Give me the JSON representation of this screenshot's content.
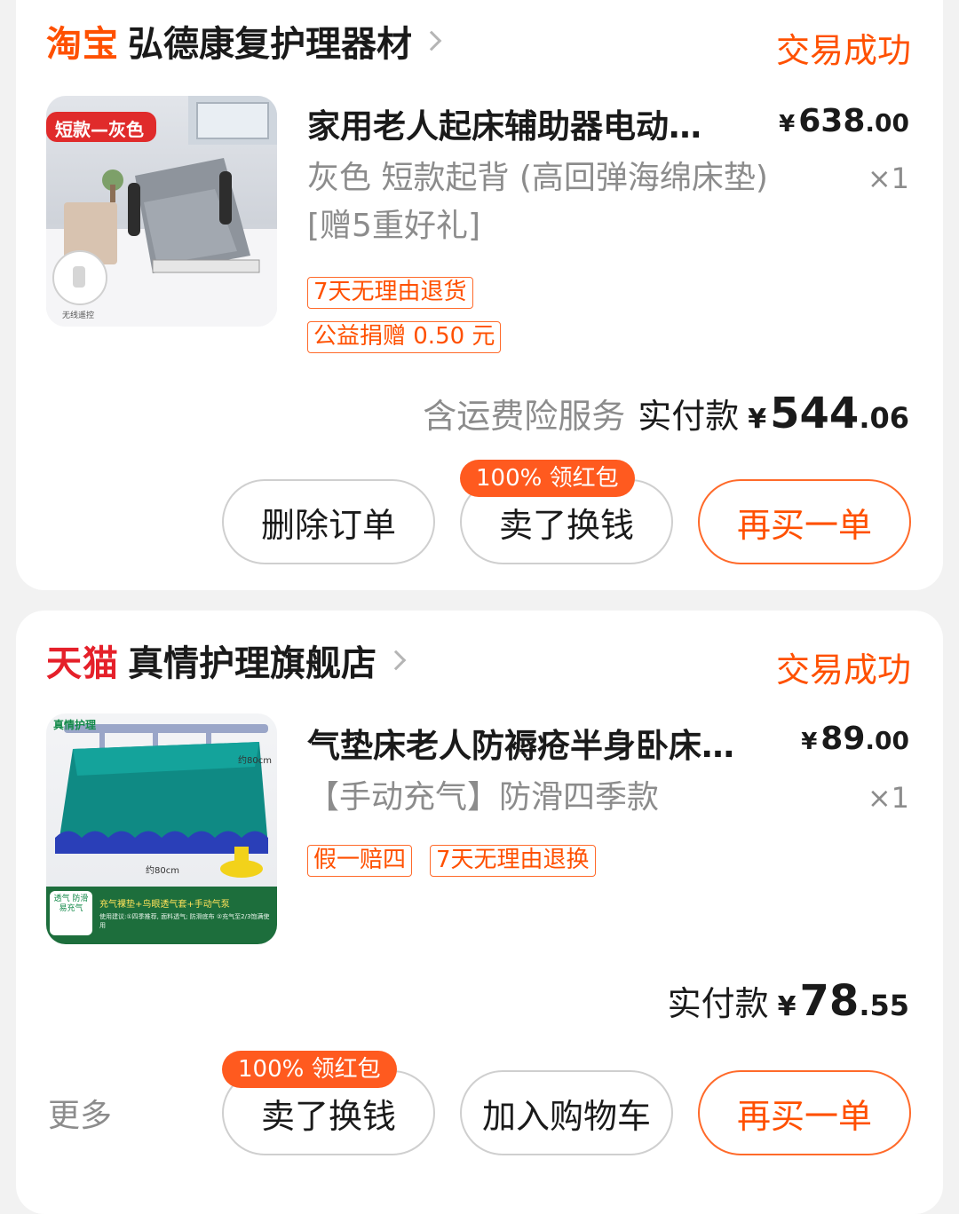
{
  "orders": [
    {
      "platform": "淘宝",
      "shop_name": "弘德康复护理器材",
      "status": "交易成功",
      "image_label": "短款—灰色",
      "image_caption": "无线遥控",
      "item_title": "家用老人起床辅助器电动…",
      "price_symbol": "¥",
      "price_int": "638",
      "price_dec": ".00",
      "quantity": "×1",
      "spec": "灰色 短款起背 (高回弹海绵床垫)[赠5重好礼]",
      "tags": [
        "7天无理由退货",
        "公益捐赠 0.50 元"
      ],
      "service_note": "含运费险服务",
      "total_label": "实付款",
      "total_symbol": "¥",
      "total_int": "544",
      "total_dec": ".06",
      "buttons": [
        "删除订单",
        "卖了换钱",
        "再买一单"
      ],
      "badge": "100% 领红包"
    },
    {
      "platform": "天猫",
      "shop_name": "真情护理旗舰店",
      "status": "交易成功",
      "image_brand": "真情护理",
      "image_dim_top": "约80cm",
      "image_dim_bottom": "约80cm",
      "image_side_note": "透气 防滑 易充气",
      "image_caption": "充气裸垫+鸟眼透气套+手动气泵",
      "image_usage": "使用建议:①四季推荐, 面料透气; 防滑底布 ②充气至2/3饱满使用",
      "item_title": "气垫床老人防褥疮半身卧床…",
      "price_symbol": "¥",
      "price_int": "89",
      "price_dec": ".00",
      "quantity": "×1",
      "spec": "【手动充气】防滑四季款",
      "tags": [
        "假一赔四",
        "7天无理由退换"
      ],
      "total_label": "实付款",
      "total_symbol": "¥",
      "total_int": "78",
      "total_dec": ".55",
      "more_label": "更多",
      "buttons": [
        "卖了换钱",
        "加入购物车",
        "再买一单"
      ],
      "badge": "100% 领红包"
    }
  ]
}
